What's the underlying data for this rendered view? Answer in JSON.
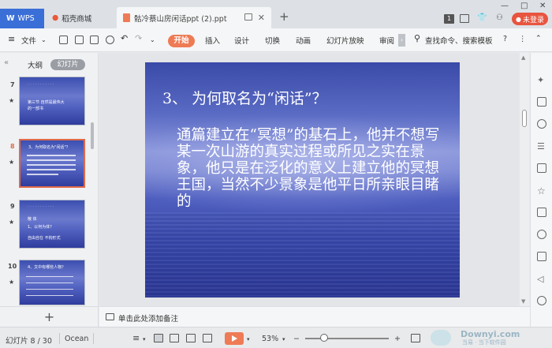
{
  "tabs": {
    "wps": "WPS",
    "store": "稻壳商城",
    "document": "骷冷蔡山房闲话ppt (2).ppt"
  },
  "window": {
    "page_badge": "1",
    "not_logged_in": "未登录"
  },
  "toolbar": {
    "file": "文件",
    "start": "开始",
    "insert": "插入",
    "design": "设计",
    "transition": "切换",
    "animation": "动画",
    "slideshow": "幻灯片放映",
    "review": "审阅",
    "search": "查找命令、搜索模板"
  },
  "left_panel": {
    "outline_tab": "大纲",
    "slides_tab": "幻灯片",
    "thumbnails": [
      {
        "num": "7",
        "lines": [
          "第三节  自然是最伟大",
          "的一部书"
        ]
      },
      {
        "num": "8",
        "lines": [
          "3、为何取名为\"闲话\"？"
        ]
      },
      {
        "num": "9",
        "lines": [
          "散  体",
          "1、以何为体？",
          "自由自在    不拘形式"
        ]
      },
      {
        "num": "10",
        "lines": [
          "4、文中有哪些人物？"
        ]
      }
    ]
  },
  "slide": {
    "title": "3、  为何取名为“闲话”？",
    "body": "通篇建立在“冥想”的基石上，他并不想写某一次山游的真实过程或所见之实在景象，他只是在泛化的意义上建立他的冥想王国，当然不少景象是他平日所亲眼目睹的"
  },
  "notes": {
    "placeholder": "单击此处添加备注"
  },
  "statusbar": {
    "slide_counter": "幻灯片 8 / 30",
    "theme": "Ocean",
    "zoom": "53%",
    "zoom_minus": "−",
    "zoom_plus": "+"
  },
  "watermark": {
    "main": "Downyi.com",
    "sub": "当易 · 当下软件园"
  },
  "colors": {
    "accent": "#ee7b55",
    "wps_blue": "#3b6fd8",
    "not_logged_red": "#e8543f"
  }
}
